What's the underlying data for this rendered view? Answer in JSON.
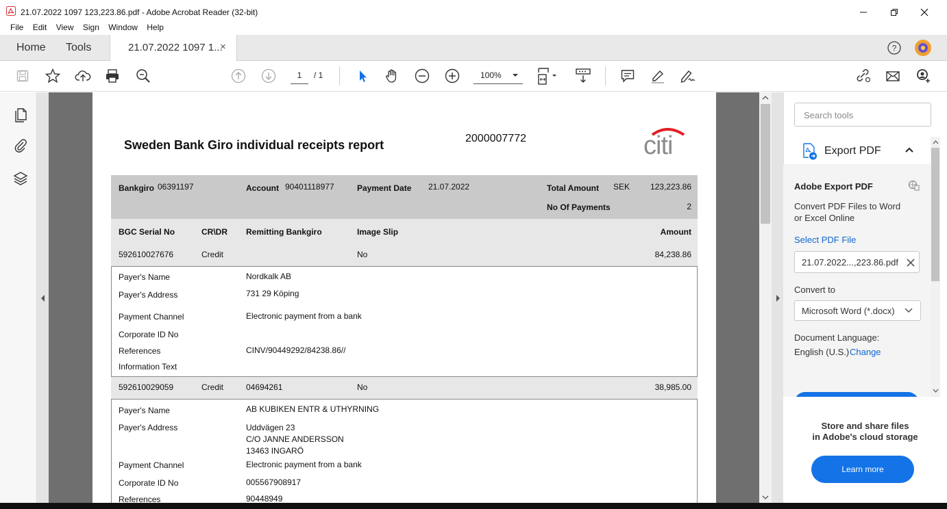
{
  "window": {
    "title": "21.07.2022 1097 123,223.86.pdf - Adobe Acrobat Reader (32-bit)"
  },
  "menu": [
    "File",
    "Edit",
    "View",
    "Sign",
    "Window",
    "Help"
  ],
  "tabs": {
    "home": "Home",
    "tools": "Tools",
    "document": "21.07.2022 1097 1...",
    "close": "×"
  },
  "toolbar": {
    "page_current": "1",
    "page_total": "/ 1",
    "zoom": "100%"
  },
  "report": {
    "title": "Sweden Bank Giro individual receipts report",
    "number": "2000007772",
    "logo": "citi",
    "header": {
      "bankgiro_label": "Bankgiro",
      "bankgiro_value": "06391197",
      "account_label": "Account",
      "account_value": "90401118977",
      "payment_date_label": "Payment Date",
      "payment_date_value": "21.07.2022",
      "total_amount_label": "Total Amount",
      "currency": "SEK",
      "total_amount_value": "123,223.86",
      "no_payments_label": "No Of Payments",
      "no_payments_value": "2"
    },
    "columns": {
      "serial": "BGC Serial No",
      "crdr": "CR\\DR",
      "remitting": "Remitting Bankgiro",
      "image_slip": "Image Slip",
      "amount": "Amount"
    },
    "labels": {
      "payer_name": "Payer's Name",
      "payer_address": "Payer's Address",
      "payment_channel": "Payment Channel",
      "corporate_id": "Corporate ID No",
      "references": "References",
      "information_text": "Information Text"
    },
    "payments": [
      {
        "serial": "592610027676",
        "crdr": "Credit",
        "remitting": "",
        "image_slip": "No",
        "amount": "84,238.86",
        "payer_name": "Nordkalk AB",
        "address_lines": [
          "731 29 Köping"
        ],
        "payment_channel": "Electronic payment from a bank",
        "corporate_id": "",
        "references": "CINV/90449292/84238.86//",
        "information_text": ""
      },
      {
        "serial": "592610029059",
        "crdr": "Credit",
        "remitting": "04694261",
        "image_slip": "No",
        "amount": "38,985.00",
        "payer_name": "AB KUBIKEN ENTR & UTHYRNING",
        "address_lines": [
          "Uddvägen 23",
          "C/O JANNE ANDERSSON",
          "13463 INGARÖ"
        ],
        "payment_channel": "Electronic payment from a bank",
        "corporate_id": "005567908917",
        "references": "90448949"
      }
    ]
  },
  "right_panel": {
    "search_placeholder": "Search tools",
    "export_pdf": "Export PDF",
    "adobe_export_title": "Adobe Export PDF",
    "description": "Convert PDF Files to Word or Excel Online",
    "select_pdf_file": "Select PDF File",
    "selected_file": "21.07.2022...,223.86.pdf",
    "convert_to_label": "Convert to",
    "convert_to_value": "Microsoft Word (*.docx)",
    "document_language_label": "Document Language:",
    "document_language_value": "English (U.S.)",
    "change_link": "Change",
    "store_line1": "Store and share files",
    "store_line2": "in Adobe's cloud storage",
    "learn_more": "Learn more"
  },
  "colors": {
    "accent_blue": "#1473e6",
    "link_blue": "#0d66d0",
    "acrobat_red": "#d7373f",
    "report_gray": "#c9c9c9",
    "citi_red": "#e31e24",
    "citi_gray": "#8a8c8e"
  }
}
